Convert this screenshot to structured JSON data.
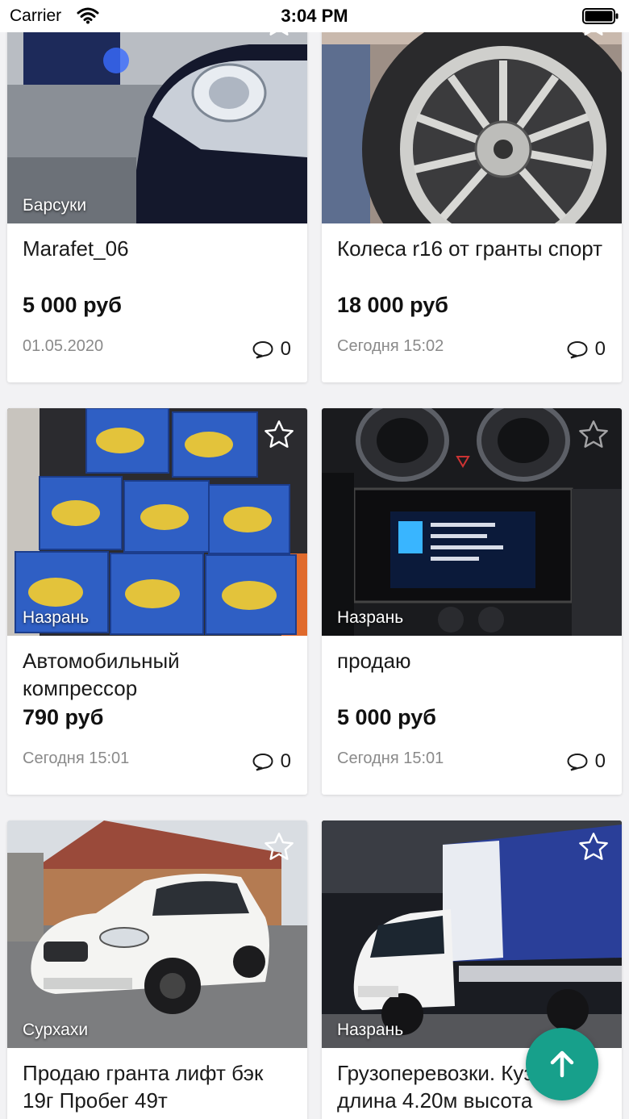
{
  "status_bar": {
    "carrier": "Carrier",
    "time": "3:04 PM"
  },
  "listings": [
    {
      "title": "Marafet_06",
      "price": "5 000 руб",
      "date": "01.05.2020",
      "location": "Барсуки",
      "comments": "0",
      "favorite_icon": "star-outline-icon",
      "photo": "car-headlight"
    },
    {
      "title": "Колеса r16 от гранты спорт",
      "price": "18 000 руб",
      "date": "Сегодня 15:02",
      "location": "",
      "comments": "0",
      "favorite_icon": "star-outline-icon",
      "photo": "alloy-wheel"
    },
    {
      "title": "Автомобильный компрессор",
      "price": "790 руб",
      "date": "Сегодня 15:01",
      "location": "Назрань",
      "comments": "0",
      "favorite_icon": "star-outline-icon",
      "photo": "compressor-boxes"
    },
    {
      "title": "продаю",
      "price": "5 000 руб",
      "date": "Сегодня 15:01",
      "location": "Назрань",
      "comments": "0",
      "favorite_icon": "star-outline-icon",
      "photo": "car-stereo"
    },
    {
      "title": "Продаю гранта лифт бэк 19г Пробег 49т",
      "price": "",
      "date": "",
      "location": "Сурхахи",
      "comments": "",
      "favorite_icon": "star-outline-icon",
      "photo": "white-sedan"
    },
    {
      "title": "Грузоперевозки. Кузов длина 4.20м высота",
      "price": "",
      "date": "",
      "location": "Назрань",
      "comments": "",
      "favorite_icon": "star-outline-icon",
      "photo": "cargo-truck"
    }
  ],
  "fab": {
    "icon": "arrow-up-icon",
    "color": "#17a08b"
  },
  "colors": {
    "background": "#f2f2f4",
    "card": "#ffffff",
    "date_text": "#8a8a8a"
  }
}
